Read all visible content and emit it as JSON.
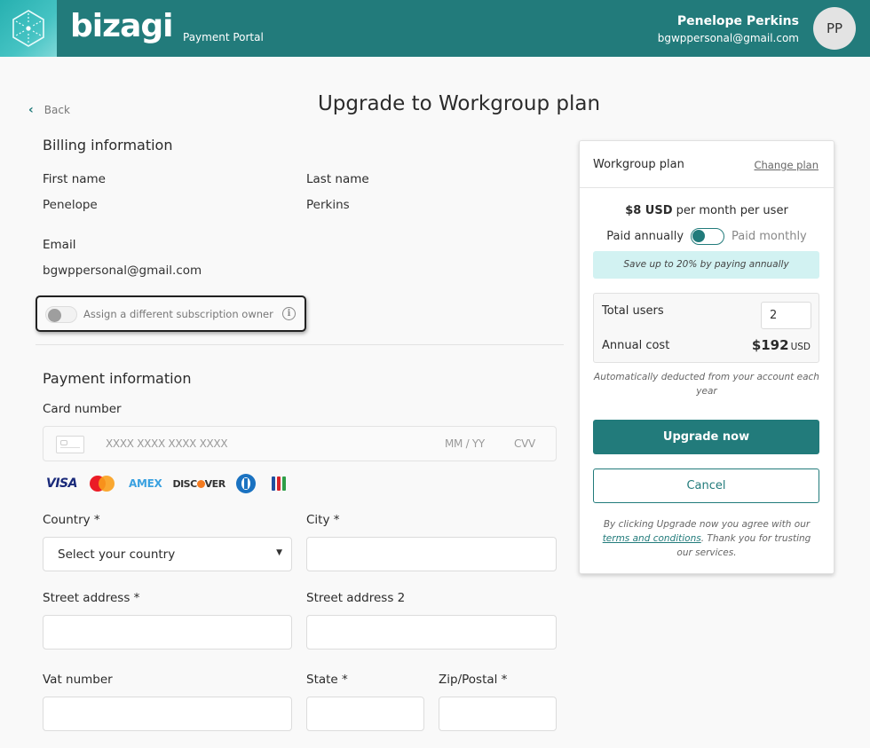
{
  "header": {
    "brand": "bizagi",
    "subtitle": "Payment Portal",
    "user_name": "Penelope Perkins",
    "user_email": "bgwppersonal@gmail.com",
    "avatar_initials": "PP",
    "brand_color": "#227b7b"
  },
  "nav": {
    "back_label": "Back"
  },
  "page": {
    "title": "Upgrade to Workgroup plan"
  },
  "billing": {
    "heading": "Billing information",
    "first_name_label": "First name",
    "first_name": "Penelope",
    "last_name_label": "Last name",
    "last_name": "Perkins",
    "email_label": "Email",
    "email": "bgwppersonal@gmail.com",
    "owner_toggle_label": "Assign a different subscription owner",
    "owner_toggle_on": false
  },
  "payment": {
    "heading": "Payment information",
    "card_label": "Card number",
    "card_placeholder": "XXXX XXXX XXXX XXXX",
    "expiry_placeholder": "MM / YY",
    "cvv_placeholder": "CVV",
    "card_brands": [
      "VISA",
      "Mastercard",
      "AMEX",
      "DISCOVER",
      "Diners Club",
      "JCB"
    ],
    "country_label": "Country *",
    "country_value": "Select your country",
    "city_label": "City *",
    "city_value": "",
    "street_label": "Street address *",
    "street_value": "",
    "street2_label": "Street address 2",
    "street2_value": "",
    "vat_label": "Vat number",
    "vat_value": "",
    "state_label": "State *",
    "state_value": "",
    "zip_label": "Zip/Postal *",
    "zip_value": ""
  },
  "plan": {
    "name": "Workgroup plan",
    "change_label": "Change plan",
    "price_amount": "$8 USD",
    "price_suffix": " per month per user",
    "annual_label": "Paid annually",
    "monthly_label": "Paid monthly",
    "billing_period": "annual",
    "save_banner": "Save up to 20% by paying annually",
    "total_users_label": "Total users",
    "total_users": "2",
    "annual_cost_label": "Annual cost",
    "annual_cost": "$192",
    "currency": "USD",
    "auto_note": "Automatically deducted from your account each year",
    "upgrade_label": "Upgrade now",
    "cancel_label": "Cancel",
    "terms_prefix": "By clicking Upgrade now you agree with our ",
    "terms_link": "terms and conditions",
    "terms_suffix": ". Thank you for trusting our services."
  }
}
